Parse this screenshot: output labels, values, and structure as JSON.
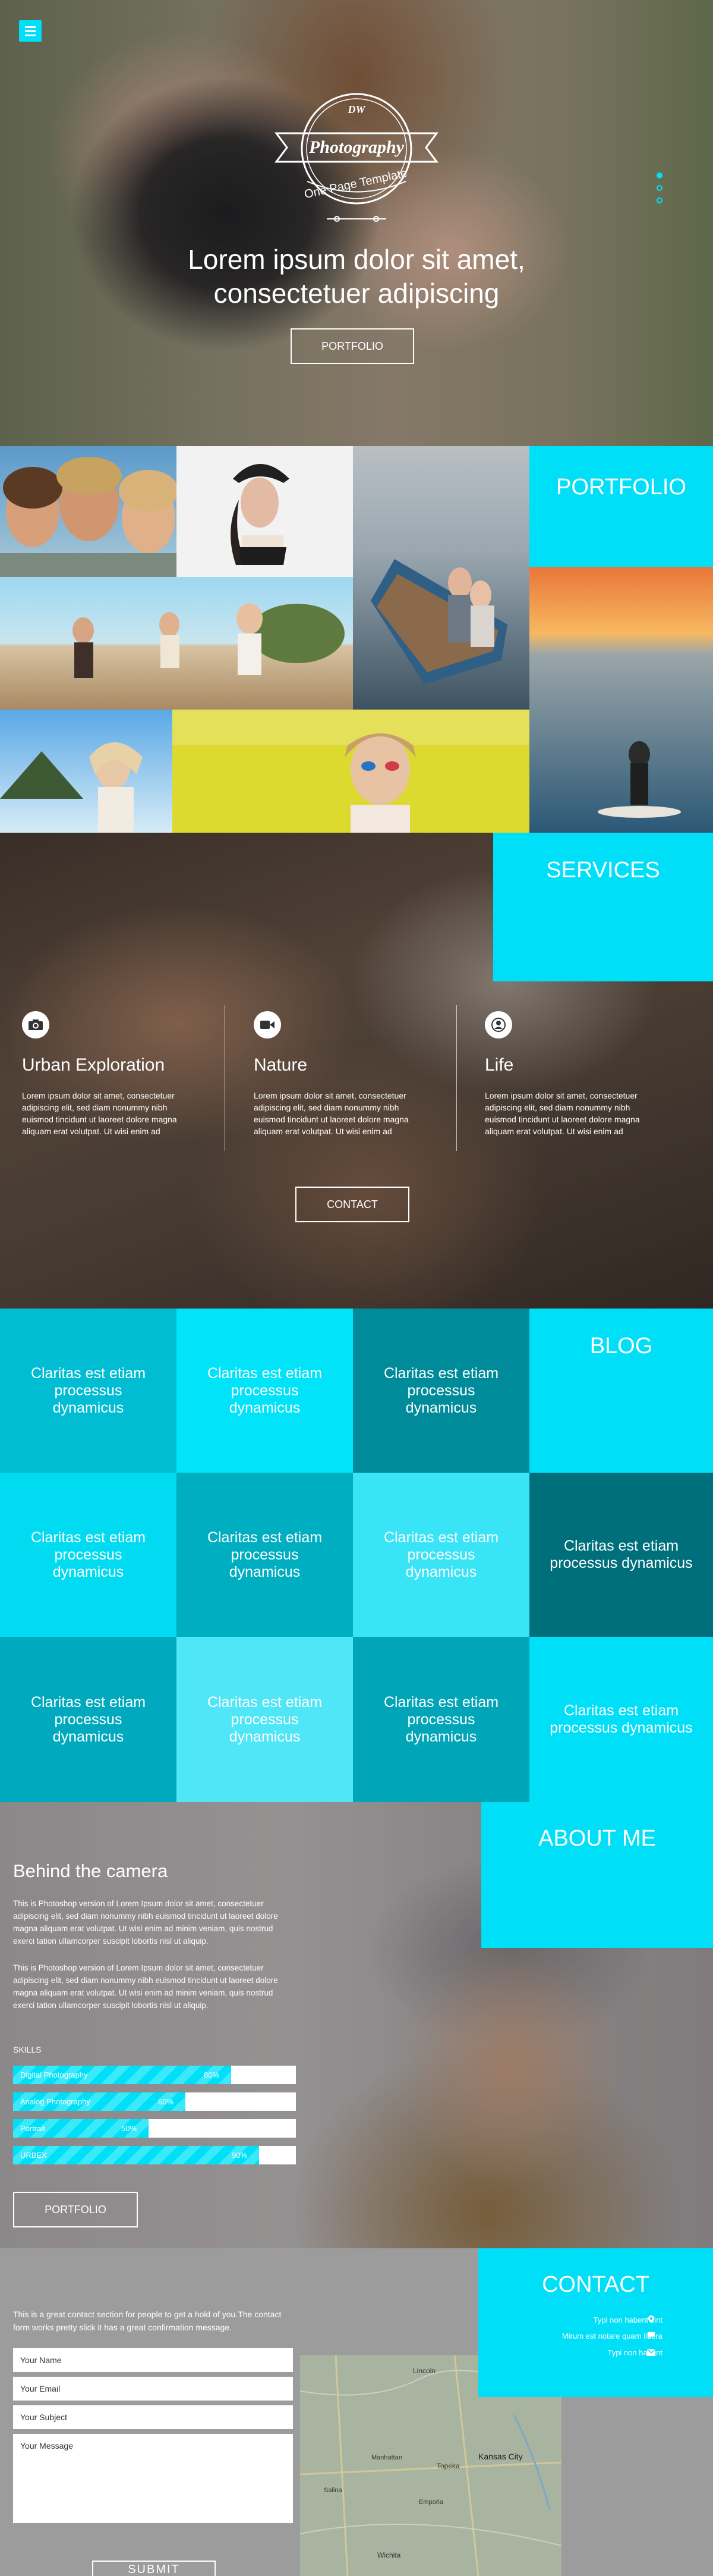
{
  "hero": {
    "logo_initials": "DW",
    "logo_title": "Photography",
    "logo_subtitle": "One Page Template",
    "heading_line1": "Lorem ipsum dolor sit amet,",
    "heading_line2": "consectetuer adipiscing",
    "button_label": "PORTFOLIO",
    "slides": 3,
    "active_slide": 1
  },
  "portfolio": {
    "title": "PORTFOLIO"
  },
  "services": {
    "title": "SERVICES",
    "items": [
      {
        "icon": "camera-icon",
        "title": "Urban Exploration",
        "text": "Lorem ipsum dolor sit amet, consectetuer adipiscing elit, sed diam nonummy nibh euismod tincidunt ut laoreet dolore magna aliquam erat volutpat. Ut wisi enim ad"
      },
      {
        "icon": "video-camera-icon",
        "title": "Nature",
        "text": "Lorem ipsum dolor sit amet, consectetuer adipiscing elit, sed diam nonummy nibh euismod tincidunt ut laoreet dolore magna aliquam erat volutpat. Ut wisi enim ad"
      },
      {
        "icon": "user-icon",
        "title": "Life",
        "text": "Lorem ipsum dolor sit amet, consectetuer adipiscing elit, sed diam nonummy nibh euismod tincidunt ut laoreet dolore magna aliquam erat volutpat. Ut wisi enim ad"
      }
    ],
    "button_label": "CONTACT"
  },
  "blog": {
    "title": "BLOG",
    "tiles": [
      {
        "text": "Claritas est etiam processus dynamicus",
        "color": "#00bdd4"
      },
      {
        "text": "Claritas est etiam processus dynamicus",
        "color": "#00e3f9"
      },
      {
        "text": "Claritas est etiam processus dynamicus",
        "color": "#008b9b"
      },
      {
        "text": "Claritas est etiam processus dynamicus",
        "color": "#00dbf2"
      },
      {
        "text": "Claritas est etiam processus dynamicus",
        "color": "#00aec2"
      },
      {
        "text": "Claritas est etiam processus dynamicus",
        "color": "#39e4f7"
      },
      {
        "text": "Claritas est etiam processus dynamicus",
        "color": "#006f7c"
      },
      {
        "text": "Claritas est etiam processus dynamicus",
        "color": "#00a9bd"
      },
      {
        "text": "Claritas est etiam processus dynamicus",
        "color": "#4fe6f8"
      },
      {
        "text": "Claritas est etiam processus dynamicus",
        "color": "#00a5b8"
      },
      {
        "text": "Claritas est etiam processus dynamicus",
        "color": "#00dff8"
      }
    ]
  },
  "about": {
    "title": "ABOUT ME",
    "heading": "Behind the camera",
    "paragraph1": "This is Photoshop version of Lorem Ipsum dolor sit amet, consectetuer adipiscing elit, sed diam nonummy nibh euismod tincidunt ut laoreet dolore magna aliquam erat volutpat. Ut wisi enim ad minim veniam, quis nostrud exerci tation ullamcorper suscipit lobortis nisl ut aliquip.",
    "paragraph2": "This is Photoshop version of Lorem Ipsum dolor sit amet, consectetuer adipiscing elit, sed diam nonummy nibh euismod tincidunt ut laoreet dolore magna aliquam erat volutpat. Ut wisi enim ad minim veniam, quis nostrud exerci tation ullamcorper suscipit lobortis nisl ut aliquip.",
    "skills_label": "SKILLS",
    "skills": [
      {
        "name": "Digital Photography",
        "pct_label": "80%",
        "value": 0.77
      },
      {
        "name": "Analog Photography",
        "pct_label": "60%",
        "value": 0.61
      },
      {
        "name": "Portrait",
        "pct_label": "50%",
        "value": 0.48
      },
      {
        "name": "URBEX",
        "pct_label": "90%",
        "value": 0.87
      }
    ],
    "button_label": "PORTFOLIO"
  },
  "contact": {
    "title": "CONTACT",
    "intro": "This is a great contact section for people to get a hold of you.The contact form works pretty slick it has a great confirmation message.",
    "lines": [
      {
        "text": "Typi non habent sint",
        "icon": "location-pin-icon"
      },
      {
        "text": "Mirum est notare quam littera",
        "icon": "chat-bubble-icon"
      },
      {
        "text": "Typi non habent",
        "icon": "envelope-icon"
      }
    ],
    "name_placeholder": "Your Name",
    "email_placeholder": "Your Email",
    "subject_placeholder": "Your Subject",
    "message_placeholder": "Your Message",
    "submit_label": "SUBMIT",
    "map_labels": [
      "Lincoln",
      "Topeka",
      "Kansas City",
      "Manhattan",
      "Salina",
      "Emporia",
      "Wichita"
    ]
  }
}
